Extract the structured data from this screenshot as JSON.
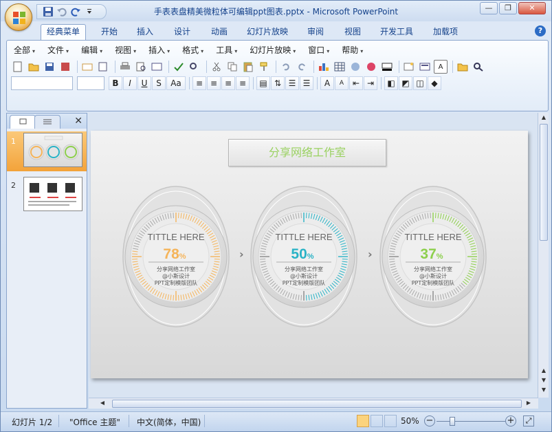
{
  "window": {
    "title": "手表表盘精美微粒体可编辑ppt图表.pptx - Microsoft PowerPoint",
    "controls": {
      "minimize": "—",
      "restore": "❐",
      "close": "✕"
    }
  },
  "quick_access": {
    "icons": [
      "save-icon",
      "undo-icon",
      "redo-icon",
      "customize-icon"
    ]
  },
  "ribbon": {
    "tabs": [
      {
        "label": "经典菜单",
        "active": true
      },
      {
        "label": "开始"
      },
      {
        "label": "插入"
      },
      {
        "label": "设计"
      },
      {
        "label": "动画"
      },
      {
        "label": "幻灯片放映"
      },
      {
        "label": "审阅"
      },
      {
        "label": "视图"
      },
      {
        "label": "开发工具"
      },
      {
        "label": "加载项"
      }
    ],
    "help": "?"
  },
  "menubar": {
    "items": [
      "全部",
      "文件",
      "编辑",
      "视图",
      "插入",
      "格式",
      "工具",
      "幻灯片放映",
      "窗口",
      "帮助"
    ],
    "arrow": "▾"
  },
  "format_buttons": {
    "bold": "B",
    "italic": "I",
    "underline": "U",
    "strike": "S",
    "case": "Aa"
  },
  "slides_pane": {
    "close": "✕",
    "slides": [
      {
        "number": "1",
        "selected": true
      },
      {
        "number": "2",
        "selected": false
      }
    ]
  },
  "slide": {
    "title": "分享网络工作室",
    "gauges": [
      {
        "heading": "TITTLE HERE",
        "value": "78",
        "unit": "%",
        "percent": 78,
        "color": "#f5b45a",
        "line1": "分享网络工作室",
        "line2": "@小斯设计",
        "line3": "PPT定制模版团队"
      },
      {
        "heading": "TITTLE HERE",
        "value": "50",
        "unit": "%",
        "percent": 50,
        "color": "#2ab3c6",
        "line1": "分享网络工作室",
        "line2": "@小斯设计",
        "line3": "PPT定制模版团队"
      },
      {
        "heading": "TITTLE HERE",
        "value": "37",
        "unit": "%",
        "percent": 37,
        "color": "#8dcf4d",
        "line1": "分享网络工作室",
        "line2": "@小斯设计",
        "line3": "PPT定制模版团队"
      }
    ],
    "chevron": "›"
  },
  "status": {
    "slide_count": "幻灯片 1/2",
    "theme": "\"Office 主题\"",
    "language": "中文(简体，中国)",
    "zoom": "50%",
    "zoom_out": "−",
    "zoom_in": "+"
  }
}
